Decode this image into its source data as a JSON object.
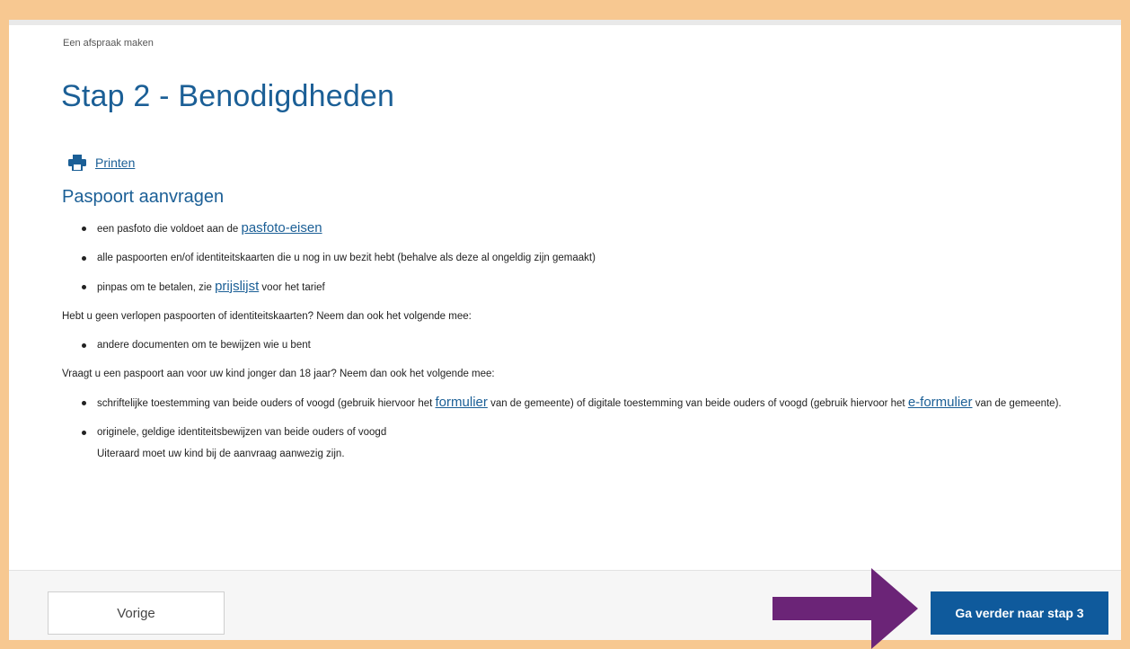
{
  "breadcrumb": "Een afspraak maken",
  "title": "Stap 2 - Benodigdheden",
  "print_label": "Printen",
  "section_title": "Paspoort aanvragen",
  "list1": [
    {
      "pre": "een pasfoto die voldoet aan de ",
      "link": "pasfoto-eisen",
      "post": ""
    },
    {
      "pre": "alle paspoorten en/of identiteitskaarten die u nog in uw bezit hebt (behalve als deze al ongeldig zijn gemaakt)",
      "link": "",
      "post": ""
    },
    {
      "pre": "pinpas om te betalen, zie ",
      "link": "prijslijst",
      "post": " voor het tarief"
    }
  ],
  "para1": "Hebt u geen verlopen paspoorten of identiteitskaarten? Neem dan ook het volgende mee:",
  "list2": [
    "andere documenten om te bewijzen wie u bent"
  ],
  "para2": "Vraagt u een paspoort aan voor uw kind jonger dan 18 jaar? Neem dan ook het volgende mee:",
  "list3": {
    "item1": {
      "pre": "schriftelijke toestemming van beide ouders of voogd (gebruik hiervoor het ",
      "link1": "formulier",
      "mid": " van de gemeente) of digitale toestemming van beide ouders of voogd (gebruik hiervoor het ",
      "link2": "e-formulier",
      "post": " van de gemeente)."
    },
    "item2": {
      "line1": "originele, geldige identiteitsbewijzen van beide ouders of voogd",
      "line2": "Uiteraard moet uw kind bij de aanvraag aanwezig zijn."
    }
  },
  "buttons": {
    "prev": "Vorige",
    "next": "Ga verder naar stap 3"
  },
  "colors": {
    "frame": "#f7c891",
    "accent": "#1b5f96",
    "primary_button": "#0f5a9c",
    "annotation_arrow": "#6b2477"
  },
  "icons": {
    "print": "printer-icon",
    "annotation": "arrow-right-icon"
  }
}
